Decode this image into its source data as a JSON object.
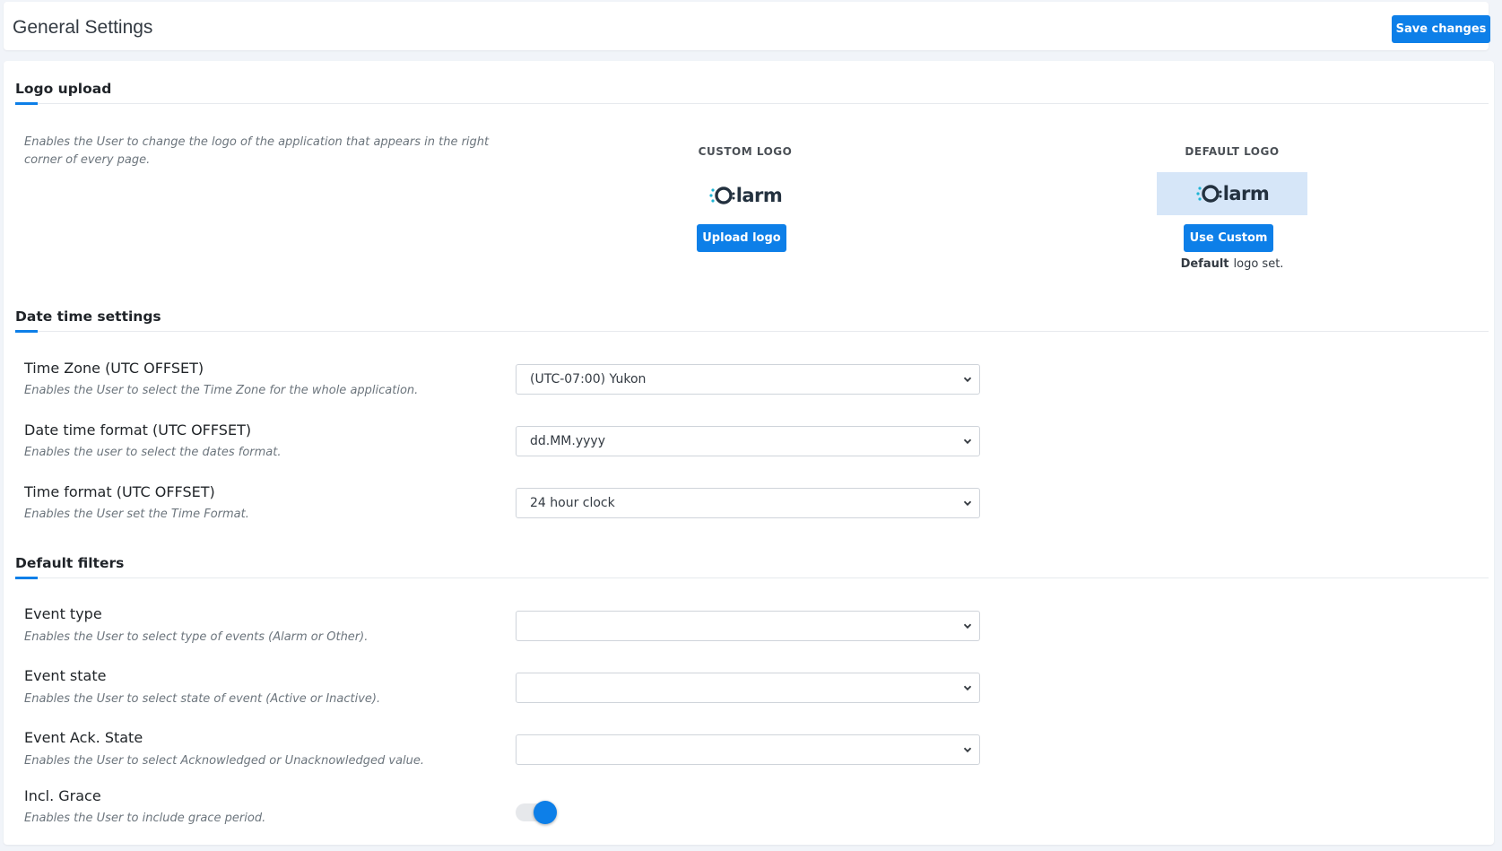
{
  "header": {
    "title": "General Settings",
    "save_label": "Save changes"
  },
  "logo_section": {
    "title": "Logo upload",
    "description": "Enables the User to change the logo of the application that appears in the right corner of every page.",
    "custom": {
      "heading": "CUSTOM LOGO",
      "logo_text": "larm",
      "button_label": "Upload logo"
    },
    "default": {
      "heading": "DEFAULT LOGO",
      "logo_text": "larm",
      "button_label": "Use Custom",
      "status_bold": "Default",
      "status_rest": "logo set."
    }
  },
  "datetime_section": {
    "title": "Date time settings",
    "rows": [
      {
        "label": "Time Zone (UTC OFFSET)",
        "description": "Enables the User to select the Time Zone for the whole application.",
        "value": "(UTC-07:00) Yukon"
      },
      {
        "label": "Date time format (UTC OFFSET)",
        "description": "Enables the user to select the dates format.",
        "value": "dd.MM.yyyy"
      },
      {
        "label": "Time format (UTC OFFSET)",
        "description": "Enables the User set the Time Format.",
        "value": "24 hour clock"
      }
    ]
  },
  "filters_section": {
    "title": "Default filters",
    "rows": [
      {
        "label": "Event type",
        "description": "Enables the User to select type of events (Alarm or Other).",
        "value": ""
      },
      {
        "label": "Event state",
        "description": "Enables the User to select state of event (Active or Inactive).",
        "value": ""
      },
      {
        "label": "Event Ack. State",
        "description": "Enables the User to select Acknowledged or Unacknowledged value.",
        "value": ""
      }
    ],
    "grace": {
      "label": "Incl. Grace",
      "description": "Enables the User to include grace period.",
      "enabled": true
    }
  },
  "colors": {
    "accent": "#0d7fe8",
    "logo_teal": "#1fb4d4",
    "logo_dark": "#23313f",
    "default_logo_bg": "#d6e6f8"
  },
  "icons": {
    "select_chevron": "chevron-down-icon",
    "logo_mark": "oalarm-logo-icon"
  }
}
